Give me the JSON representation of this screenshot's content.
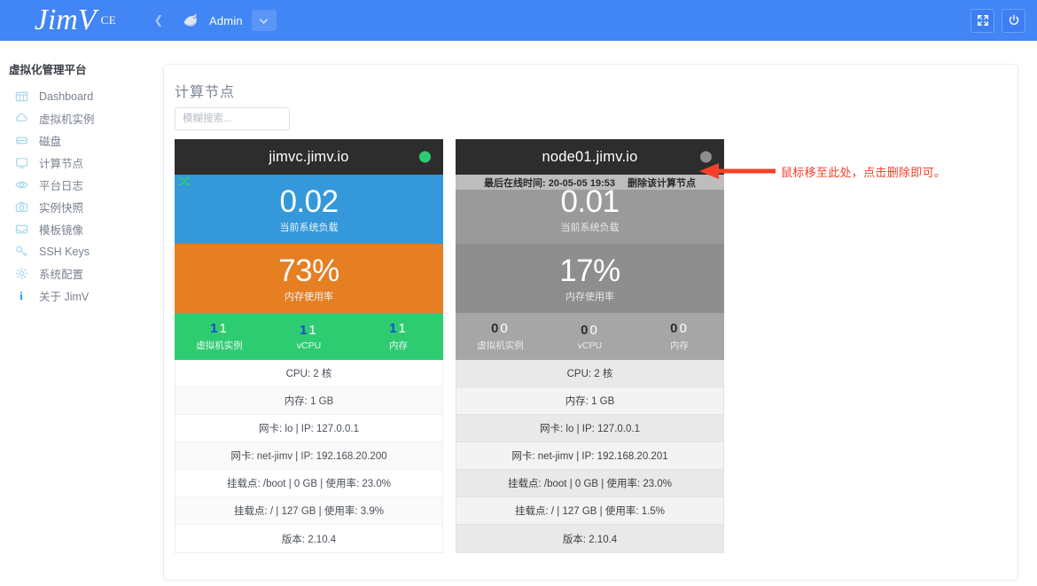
{
  "topbar": {
    "logo": "JimV",
    "logo_suffix": "CE",
    "collapse_icon": "chevron-left-icon",
    "avatar_icon": "bird-avatar",
    "user_name": "Admin",
    "caret_icon": "chevron-down-icon",
    "fullscreen_icon": "fullscreen-icon",
    "power_icon": "power-icon"
  },
  "sidebar": {
    "title": "虚拟化管理平台",
    "items": [
      {
        "label": "Dashboard",
        "icon": "dashboard-icon"
      },
      {
        "label": "虚拟机实例",
        "icon": "cloud-icon"
      },
      {
        "label": "磁盘",
        "icon": "disk-icon"
      },
      {
        "label": "计算节点",
        "icon": "monitor-icon"
      },
      {
        "label": "平台日志",
        "icon": "eye-icon"
      },
      {
        "label": "实例快照",
        "icon": "camera-icon"
      },
      {
        "label": "模板镜像",
        "icon": "inbox-icon"
      },
      {
        "label": "SSH Keys",
        "icon": "key-icon"
      },
      {
        "label": "系统配置",
        "icon": "gear-icon"
      },
      {
        "label": "关于 JimV",
        "icon": "info-icon"
      }
    ]
  },
  "page": {
    "title": "计算节点",
    "search_placeholder": "模糊搜索...",
    "search_value": ""
  },
  "nodes": [
    {
      "hostname": "jimvc.jimv.io",
      "online": true,
      "status_color": "#2ecc71",
      "load_value": "0.02",
      "load_caption": "当前系统负载",
      "mem_value": "73%",
      "mem_caption": "内存使用率",
      "stats": [
        {
          "used": "1",
          "total": "1",
          "caption": "虚拟机实例"
        },
        {
          "used": "1",
          "total": "1",
          "caption": "vCPU"
        },
        {
          "used": "1",
          "total": "1",
          "caption": "内存"
        }
      ],
      "details": [
        "CPU: 2 核",
        "内存: 1 GB",
        "网卡: lo | IP: 127.0.0.1",
        "网卡: net-jimv | IP: 192.168.20.200",
        "挂载点: /boot | 0 GB | 使用率: 23.0%",
        "挂载点: / | 127 GB | 使用率: 3.9%",
        "版本: 2.10.4"
      ]
    },
    {
      "hostname": "node01.jimv.io",
      "online": false,
      "status_color": "#8e8e8e",
      "overlay_last_seen": "最后在线时间: 20-05-05 19:53",
      "overlay_delete": "删除该计算节点",
      "load_value": "0.01",
      "load_caption": "当前系统负载",
      "mem_value": "17%",
      "mem_caption": "内存使用率",
      "stats": [
        {
          "used": "0",
          "total": "0",
          "caption": "虚拟机实例"
        },
        {
          "used": "0",
          "total": "0",
          "caption": "vCPU"
        },
        {
          "used": "0",
          "total": "0",
          "caption": "内存"
        }
      ],
      "details": [
        "CPU: 2 核",
        "内存: 1 GB",
        "网卡: lo | IP: 127.0.0.1",
        "网卡: net-jimv | IP: 192.168.20.201",
        "挂载点: /boot | 0 GB | 使用率: 23.0%",
        "挂载点: / | 127 GB | 使用率: 1.5%",
        "版本: 2.10.4"
      ]
    }
  ],
  "annotation": {
    "text": "鼠标移至此处，点击删除即可。",
    "color": "#f4402a",
    "arrow_icon": "left-arrow-icon"
  }
}
